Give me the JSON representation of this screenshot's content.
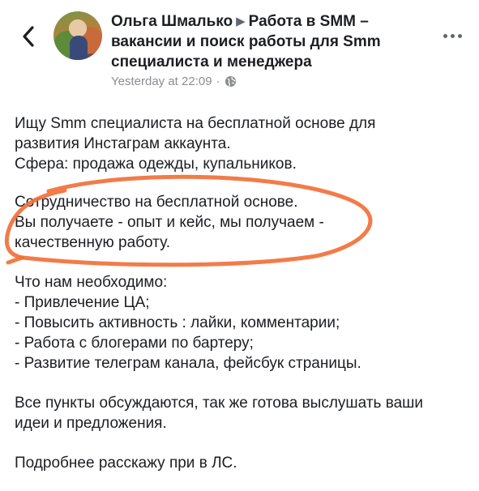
{
  "header": {
    "author": "Ольга Шмалько",
    "group": "Работа в SMM – вакансии и поиск работы для Smm специалиста и менеджера",
    "timestamp": "Yesterday at 22:09",
    "separator": "·",
    "icons": {
      "back": "chevron-left-icon",
      "privacy": "globe-icon",
      "more": "more-horizontal-icon"
    }
  },
  "post": {
    "para1": [
      "Ищу Smm специалиста на бесплатной основе для",
      "развития Инстаграм аккаунта.",
      "Сфера: продажа одежды, купальников."
    ],
    "para2": [
      "Сотрудничество на бесплатной основе.",
      "Вы получаете - опыт и кейс, мы получаем -",
      "качественную работу."
    ],
    "para3": [
      "Что нам необходимо:",
      "- Привлечение ЦА;",
      "- Повысить активность : лайки, комментарии;",
      "- Работа с блогерами по бартеру;",
      "- Развитие телеграм канала, фейсбук страницы."
    ],
    "para4": [
      "Все пункты обсуждаются, так же готова выслушать ваши",
      "идеи и предложения."
    ],
    "para5": [
      "Подробнее расскажу при в ЛС."
    ]
  },
  "colors": {
    "annotation": "#f2703a",
    "text": "#1c1e21",
    "meta": "#8a8d91"
  }
}
